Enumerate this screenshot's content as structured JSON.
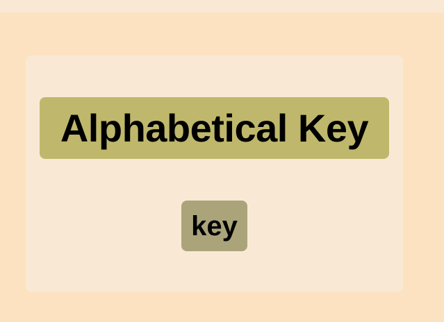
{
  "header": {
    "title": "Alphabetical Key"
  },
  "key_button": {
    "label": "key"
  },
  "colors": {
    "page_background": "#fde2c2",
    "panel_background": "#f9e9d4",
    "title_badge": "#bfb86c",
    "key_button": "#aba47b",
    "text": "#000000"
  }
}
